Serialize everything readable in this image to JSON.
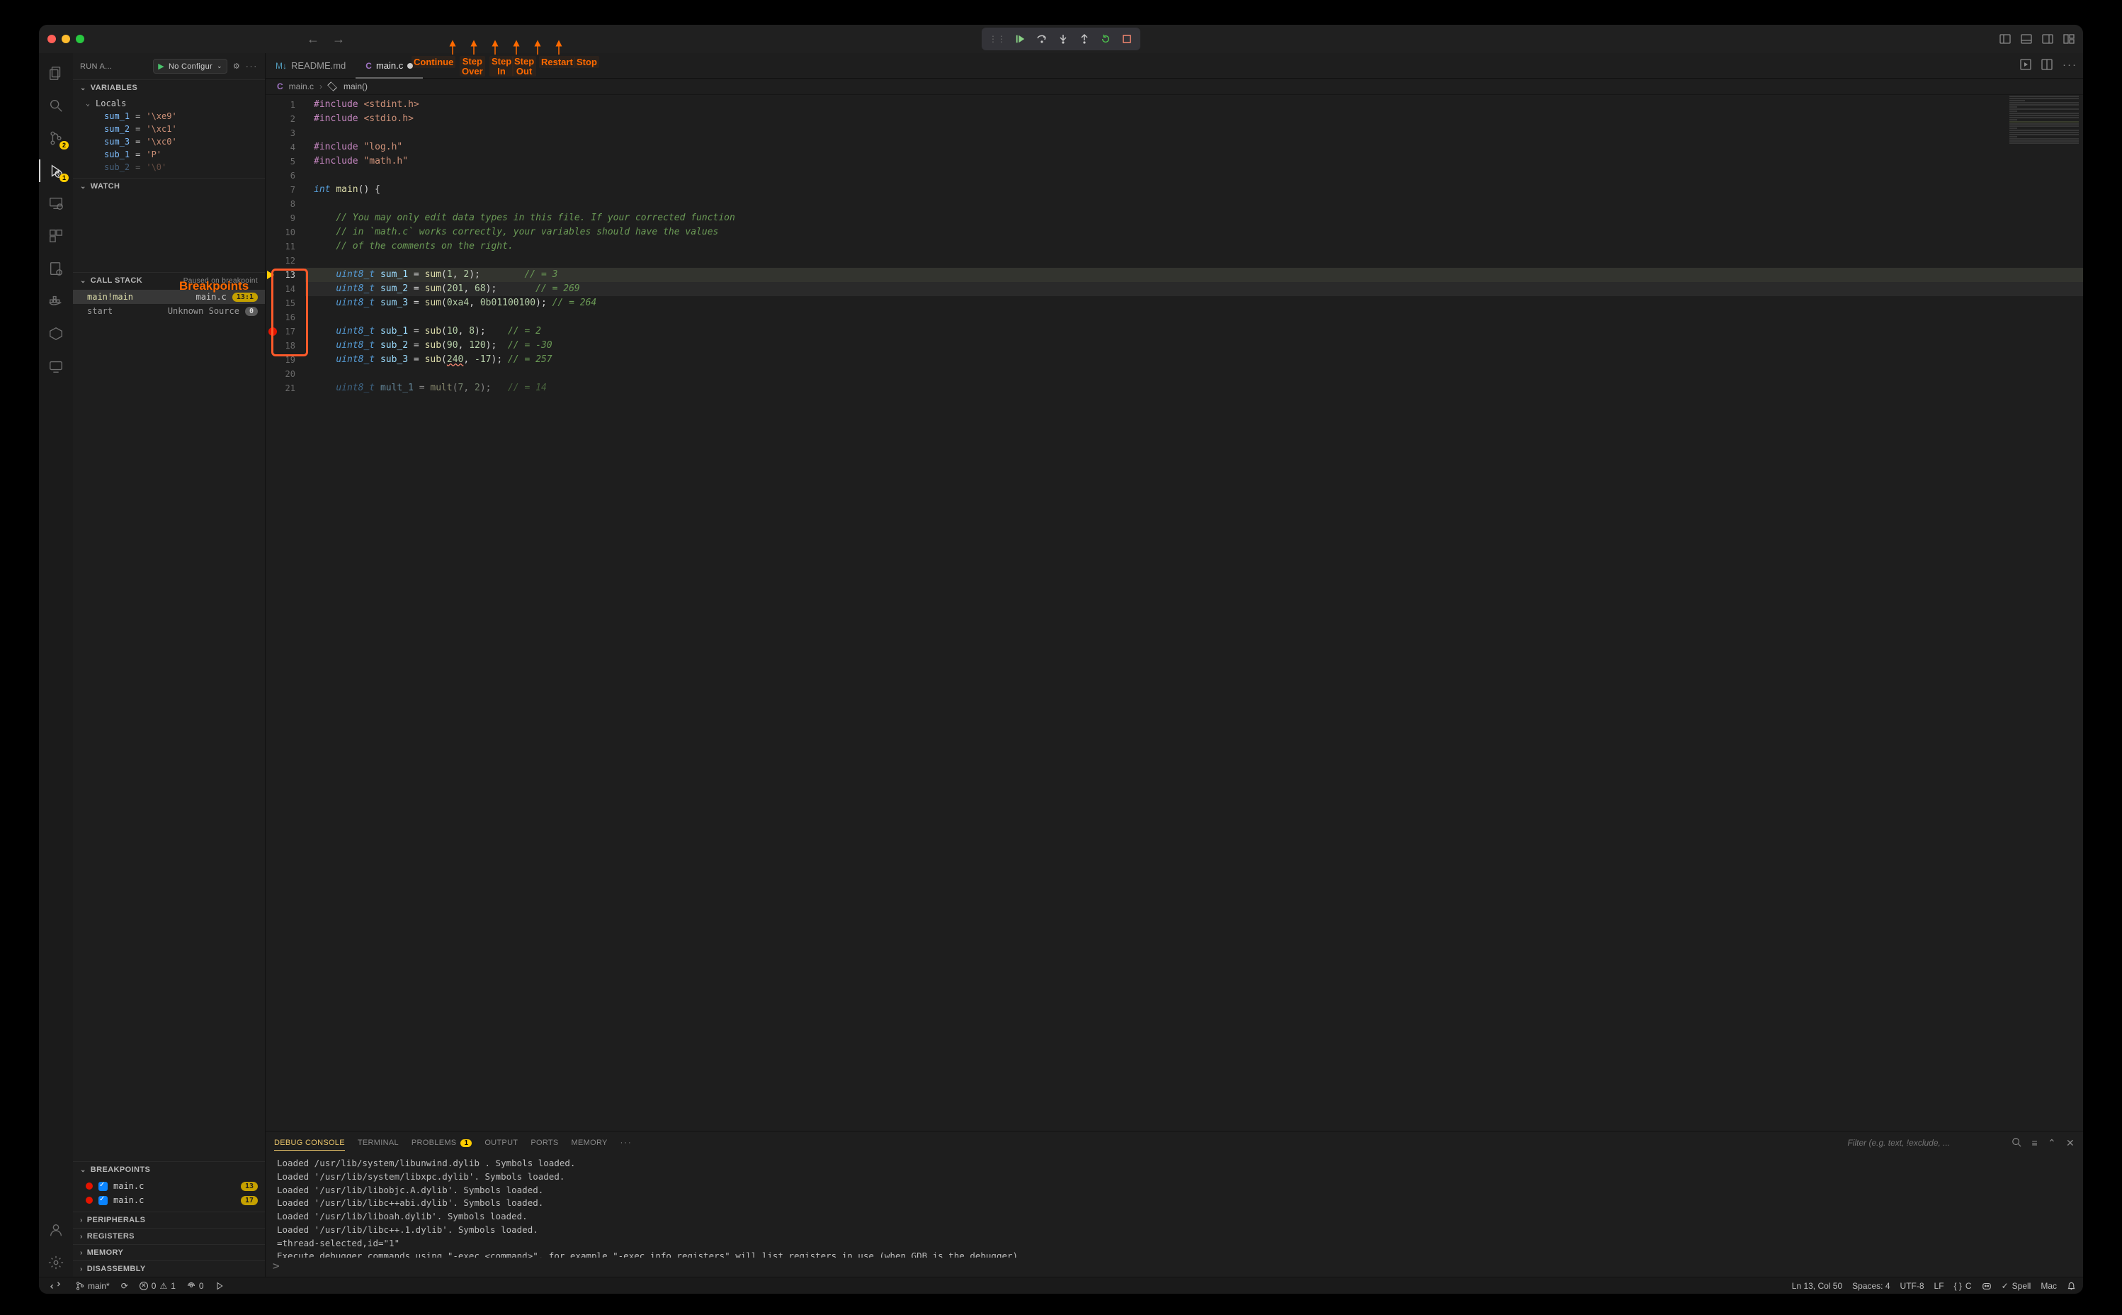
{
  "window": {
    "back": "←",
    "forward": "→"
  },
  "debugToolbar": {
    "continue": "Continue",
    "stepOver": "Step\nOver",
    "stepIn": "Step\nIn",
    "stepOut": "Step\nOut",
    "restart": "Restart",
    "stop": "Stop"
  },
  "activityBar": {
    "scmBadge": "2",
    "debugBadge": "1"
  },
  "sidebar": {
    "header": "RUN A...",
    "config": "No Configur",
    "sections": {
      "variables": {
        "title": "VARIABLES",
        "locals": "Locals",
        "vars": [
          {
            "name": "sum_1",
            "value": "'\\xe9'"
          },
          {
            "name": "sum_2",
            "value": "'\\xc1'"
          },
          {
            "name": "sum_3",
            "value": "'\\xc0'"
          },
          {
            "name": "sub_1",
            "value": "'P'"
          },
          {
            "name": "sub_2",
            "value": "'\\0'"
          }
        ]
      },
      "watch": {
        "title": "WATCH"
      },
      "callstack": {
        "title": "CALL STACK",
        "status": "Paused on breakpoint",
        "frames": [
          {
            "fn": "main!main",
            "file": "main.c",
            "loc": "13:1"
          },
          {
            "fn": "start",
            "file": "Unknown Source",
            "loc": "0"
          }
        ]
      },
      "breakpoints": {
        "title": "BREAKPOINTS",
        "list": [
          {
            "file": "main.c",
            "line": "13"
          },
          {
            "file": "main.c",
            "line": "17"
          }
        ]
      },
      "peripherals": {
        "title": "PERIPHERALS"
      },
      "registers": {
        "title": "REGISTERS"
      },
      "memory": {
        "title": "MEMORY"
      },
      "disassembly": {
        "title": "DISASSEMBLY"
      }
    }
  },
  "annotations": {
    "breakpoints": "Breakpoints"
  },
  "tabs": {
    "readme": "README.md",
    "mainc": "main.c"
  },
  "breadcrumb": {
    "file": "main.c",
    "symbol": "main()"
  },
  "code": {
    "lines": [
      "#include <stdint.h>",
      "#include <stdio.h>",
      "",
      "#include \"log.h\"",
      "#include \"math.h\"",
      "",
      "int main() {",
      "",
      "    // You may only edit data types in this file. If your corrected function",
      "    // in `math.c` works correctly, your variables should have the values",
      "    // of the comments on the right.",
      "",
      "    uint8_t sum_1 = sum(1, 2);        // = 3",
      "    uint8_t sum_2 = sum(201, 68);       // = 269",
      "    uint8_t sum_3 = sum(0xa4, 0b01100100); // = 264",
      "",
      "    uint8_t sub_1 = sub(10, 8);    // = 2",
      "    uint8_t sub_2 = sub(90, 120);  // = -30",
      "    uint8_t sub_3 = sub(240, -17); // = 257",
      "",
      "    uint8_t mult_1 = mult(7, 2);   // = 14"
    ],
    "lineNumbers": [
      "1",
      "2",
      "3",
      "4",
      "5",
      "6",
      "7",
      "8",
      "9",
      "10",
      "11",
      "12",
      "13",
      "14",
      "15",
      "16",
      "17",
      "18",
      "19",
      "20",
      "21"
    ]
  },
  "panel": {
    "tabs": {
      "debug": "DEBUG CONSOLE",
      "terminal": "TERMINAL",
      "problems": "PROBLEMS",
      "problemsCount": "1",
      "output": "OUTPUT",
      "ports": "PORTS",
      "memory": "MEMORY"
    },
    "filterPlaceholder": "Filter (e.g. text, !exclude, ...",
    "output": [
      "Loaded  /usr/lib/system/libunwind.dylib . Symbols loaded.",
      "Loaded '/usr/lib/system/libxpc.dylib'. Symbols loaded.",
      "Loaded '/usr/lib/libobjc.A.dylib'. Symbols loaded.",
      "Loaded '/usr/lib/libc++abi.dylib'. Symbols loaded.",
      "Loaded '/usr/lib/liboah.dylib'. Symbols loaded.",
      "Loaded '/usr/lib/libc++.1.dylib'. Symbols loaded.",
      "=thread-selected,id=\"1\"",
      "Execute debugger commands using \"-exec <command>\", for example \"-exec info registers\" will list registers in use (when GDB is the debugger)"
    ],
    "prompt": ">"
  },
  "statusbar": {
    "branch": "main*",
    "sync": "⟳",
    "errors": "0",
    "warnings": "1",
    "ports": "0",
    "lncol": "Ln 13, Col 50",
    "spaces": "Spaces: 4",
    "encoding": "UTF-8",
    "eol": "LF",
    "lang": "C",
    "spell": "Spell",
    "os": "Mac"
  }
}
